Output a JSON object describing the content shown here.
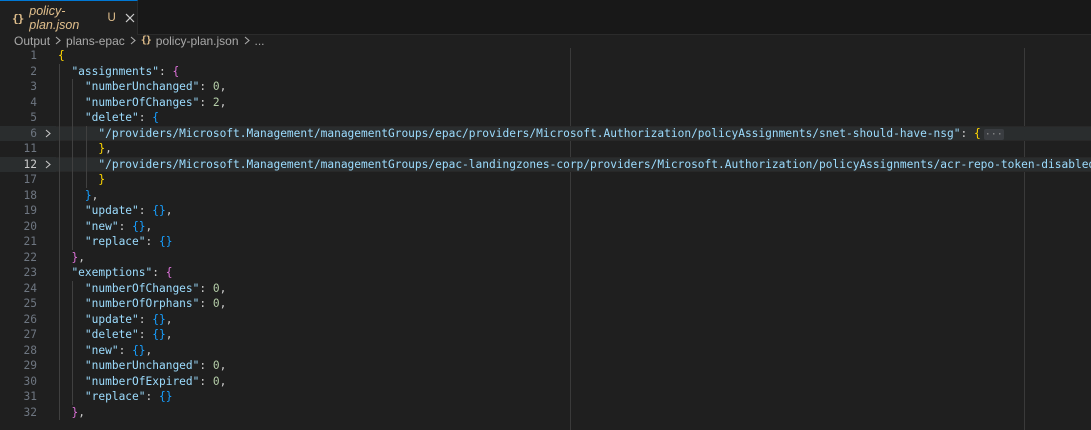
{
  "tab": {
    "icon": "{}",
    "title": "policy-plan.json",
    "status": "U"
  },
  "breadcrumb": [
    "Output",
    "plans-epac",
    "policy-plan.json",
    "..."
  ],
  "breadcrumb_json_icon": "{}",
  "editor": {
    "lines": [
      {
        "num": "1",
        "indent": 0,
        "tokens": [
          {
            "t": "{",
            "c": "b1"
          }
        ]
      },
      {
        "num": "2",
        "indent": 1,
        "tokens": [
          {
            "t": "\"assignments\"",
            "c": "k"
          },
          {
            "t": ": ",
            "c": "p"
          },
          {
            "t": "{",
            "c": "b2"
          }
        ]
      },
      {
        "num": "3",
        "indent": 2,
        "tokens": [
          {
            "t": "\"numberUnchanged\"",
            "c": "k"
          },
          {
            "t": ": ",
            "c": "p"
          },
          {
            "t": "0",
            "c": "n"
          },
          {
            "t": ",",
            "c": "p"
          }
        ]
      },
      {
        "num": "4",
        "indent": 2,
        "tokens": [
          {
            "t": "\"numberOfChanges\"",
            "c": "k"
          },
          {
            "t": ": ",
            "c": "p"
          },
          {
            "t": "2",
            "c": "n"
          },
          {
            "t": ",",
            "c": "p"
          }
        ]
      },
      {
        "num": "5",
        "indent": 2,
        "tokens": [
          {
            "t": "\"delete\"",
            "c": "k"
          },
          {
            "t": ": ",
            "c": "p"
          },
          {
            "t": "{",
            "c": "b3"
          }
        ]
      },
      {
        "num": "6",
        "indent": 3,
        "fold": true,
        "active": true,
        "tokens": [
          {
            "t": "\"/providers/Microsoft.Management/managementGroups/epac/providers/Microsoft.Authorization/policyAssignments/snet-should-have-nsg\"",
            "c": "k"
          },
          {
            "t": ": ",
            "c": "p"
          },
          {
            "t": "{",
            "c": "b1"
          },
          {
            "t": "···",
            "c": "ell"
          }
        ]
      },
      {
        "num": "11",
        "indent": 3,
        "tokens": [
          {
            "t": "}",
            "c": "b1"
          },
          {
            "t": ",",
            "c": "p"
          }
        ]
      },
      {
        "num": "12",
        "indent": 3,
        "fold": true,
        "active": true,
        "current": true,
        "tokens": [
          {
            "t": "\"/providers/Microsoft.Management/managementGroups/epac-landingzones-corp/providers/Microsoft.Authorization/policyAssignments/acr-repo-token-disabled\"",
            "c": "k"
          },
          {
            "t": ": ",
            "c": "p"
          },
          {
            "t": "{",
            "c": "b1"
          },
          {
            "t": "···",
            "c": "ell"
          }
        ]
      },
      {
        "num": "17",
        "indent": 3,
        "tokens": [
          {
            "t": "}",
            "c": "b1"
          }
        ]
      },
      {
        "num": "18",
        "indent": 2,
        "tokens": [
          {
            "t": "}",
            "c": "b3"
          },
          {
            "t": ",",
            "c": "p"
          }
        ]
      },
      {
        "num": "19",
        "indent": 2,
        "tokens": [
          {
            "t": "\"update\"",
            "c": "k"
          },
          {
            "t": ": ",
            "c": "p"
          },
          {
            "t": "{}",
            "c": "b3"
          },
          {
            "t": ",",
            "c": "p"
          }
        ]
      },
      {
        "num": "20",
        "indent": 2,
        "tokens": [
          {
            "t": "\"new\"",
            "c": "k"
          },
          {
            "t": ": ",
            "c": "p"
          },
          {
            "t": "{}",
            "c": "b3"
          },
          {
            "t": ",",
            "c": "p"
          }
        ]
      },
      {
        "num": "21",
        "indent": 2,
        "tokens": [
          {
            "t": "\"replace\"",
            "c": "k"
          },
          {
            "t": ": ",
            "c": "p"
          },
          {
            "t": "{}",
            "c": "b3"
          }
        ]
      },
      {
        "num": "22",
        "indent": 1,
        "tokens": [
          {
            "t": "}",
            "c": "b2"
          },
          {
            "t": ",",
            "c": "p"
          }
        ]
      },
      {
        "num": "23",
        "indent": 1,
        "tokens": [
          {
            "t": "\"exemptions\"",
            "c": "k"
          },
          {
            "t": ": ",
            "c": "p"
          },
          {
            "t": "{",
            "c": "b2"
          }
        ]
      },
      {
        "num": "24",
        "indent": 2,
        "tokens": [
          {
            "t": "\"numberOfChanges\"",
            "c": "k"
          },
          {
            "t": ": ",
            "c": "p"
          },
          {
            "t": "0",
            "c": "n"
          },
          {
            "t": ",",
            "c": "p"
          }
        ]
      },
      {
        "num": "25",
        "indent": 2,
        "tokens": [
          {
            "t": "\"numberOfOrphans\"",
            "c": "k"
          },
          {
            "t": ": ",
            "c": "p"
          },
          {
            "t": "0",
            "c": "n"
          },
          {
            "t": ",",
            "c": "p"
          }
        ]
      },
      {
        "num": "26",
        "indent": 2,
        "tokens": [
          {
            "t": "\"update\"",
            "c": "k"
          },
          {
            "t": ": ",
            "c": "p"
          },
          {
            "t": "{}",
            "c": "b3"
          },
          {
            "t": ",",
            "c": "p"
          }
        ]
      },
      {
        "num": "27",
        "indent": 2,
        "tokens": [
          {
            "t": "\"delete\"",
            "c": "k"
          },
          {
            "t": ": ",
            "c": "p"
          },
          {
            "t": "{}",
            "c": "b3"
          },
          {
            "t": ",",
            "c": "p"
          }
        ]
      },
      {
        "num": "28",
        "indent": 2,
        "tokens": [
          {
            "t": "\"new\"",
            "c": "k"
          },
          {
            "t": ": ",
            "c": "p"
          },
          {
            "t": "{}",
            "c": "b3"
          },
          {
            "t": ",",
            "c": "p"
          }
        ]
      },
      {
        "num": "29",
        "indent": 2,
        "tokens": [
          {
            "t": "\"numberUnchanged\"",
            "c": "k"
          },
          {
            "t": ": ",
            "c": "p"
          },
          {
            "t": "0",
            "c": "n"
          },
          {
            "t": ",",
            "c": "p"
          }
        ]
      },
      {
        "num": "30",
        "indent": 2,
        "tokens": [
          {
            "t": "\"numberOfExpired\"",
            "c": "k"
          },
          {
            "t": ": ",
            "c": "p"
          },
          {
            "t": "0",
            "c": "n"
          },
          {
            "t": ",",
            "c": "p"
          }
        ]
      },
      {
        "num": "31",
        "indent": 2,
        "tokens": [
          {
            "t": "\"replace\"",
            "c": "k"
          },
          {
            "t": ": ",
            "c": "p"
          },
          {
            "t": "{}",
            "c": "b3"
          }
        ]
      },
      {
        "num": "32",
        "indent": 1,
        "tokens": [
          {
            "t": "}",
            "c": "b2"
          },
          {
            "t": ",",
            "c": "p"
          }
        ]
      }
    ]
  },
  "colors": {
    "background": "#1f1f1f",
    "tab_accent": "#0078d4",
    "modified_file": "#e2c08d",
    "json_key": "#9cdcfe",
    "json_number": "#b5cea8",
    "bracket_level1": "#ffd700",
    "bracket_level2": "#da70d6",
    "bracket_level3": "#179fff"
  },
  "icons": {
    "tab_close": "close-icon",
    "breadcrumb_separator": "chevron-right-icon",
    "fold": "chevron-right-icon"
  }
}
